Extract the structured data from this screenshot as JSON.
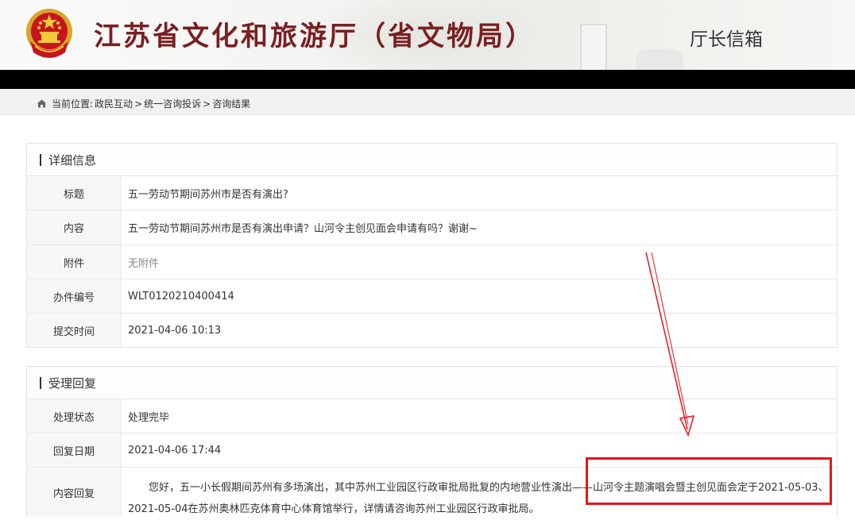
{
  "header": {
    "site_title": "江苏省文化和旅游厅（省文物局）",
    "mailbox_label": "厅长信箱",
    "emblem_icon": "national-emblem-icon"
  },
  "breadcrumb": {
    "prefix": "当前位置:",
    "items": [
      "政民互动",
      "统一咨询投诉",
      "咨询结果"
    ],
    "separator": ">"
  },
  "detail": {
    "heading": "详细信息",
    "rows": [
      {
        "label": "标题",
        "value": "五一劳动节期间苏州市是否有演出?"
      },
      {
        "label": "内容",
        "value": "五一劳动节期间苏州市是否有演出申请？山河令主创见面会申请有吗？谢谢~"
      },
      {
        "label": "附件",
        "value": "无附件"
      },
      {
        "label": "办件编号",
        "value": "WLT0120210400414"
      },
      {
        "label": "提交时间",
        "value": "2021-04-06 10:13"
      }
    ]
  },
  "reply": {
    "heading": "受理回复",
    "rows": [
      {
        "label": "处理状态",
        "value": "处理完毕"
      },
      {
        "label": "回复日期",
        "value": "2021-04-06 17:44"
      },
      {
        "label": "内容回复",
        "value": "您好，五一小长假期间苏州有多场演出，其中苏州工业园区行政审批局批复的内地营业性演出——山河令主题演唱会暨主创见面会定于2021-05-03、2021-05-04在苏州奥林匹克体育中心体育馆举行，详情请咨询苏州工业园区行政审批局。"
      }
    ]
  },
  "colors": {
    "title_red": "#7a1f22",
    "annotation_red": "#e8141a"
  }
}
